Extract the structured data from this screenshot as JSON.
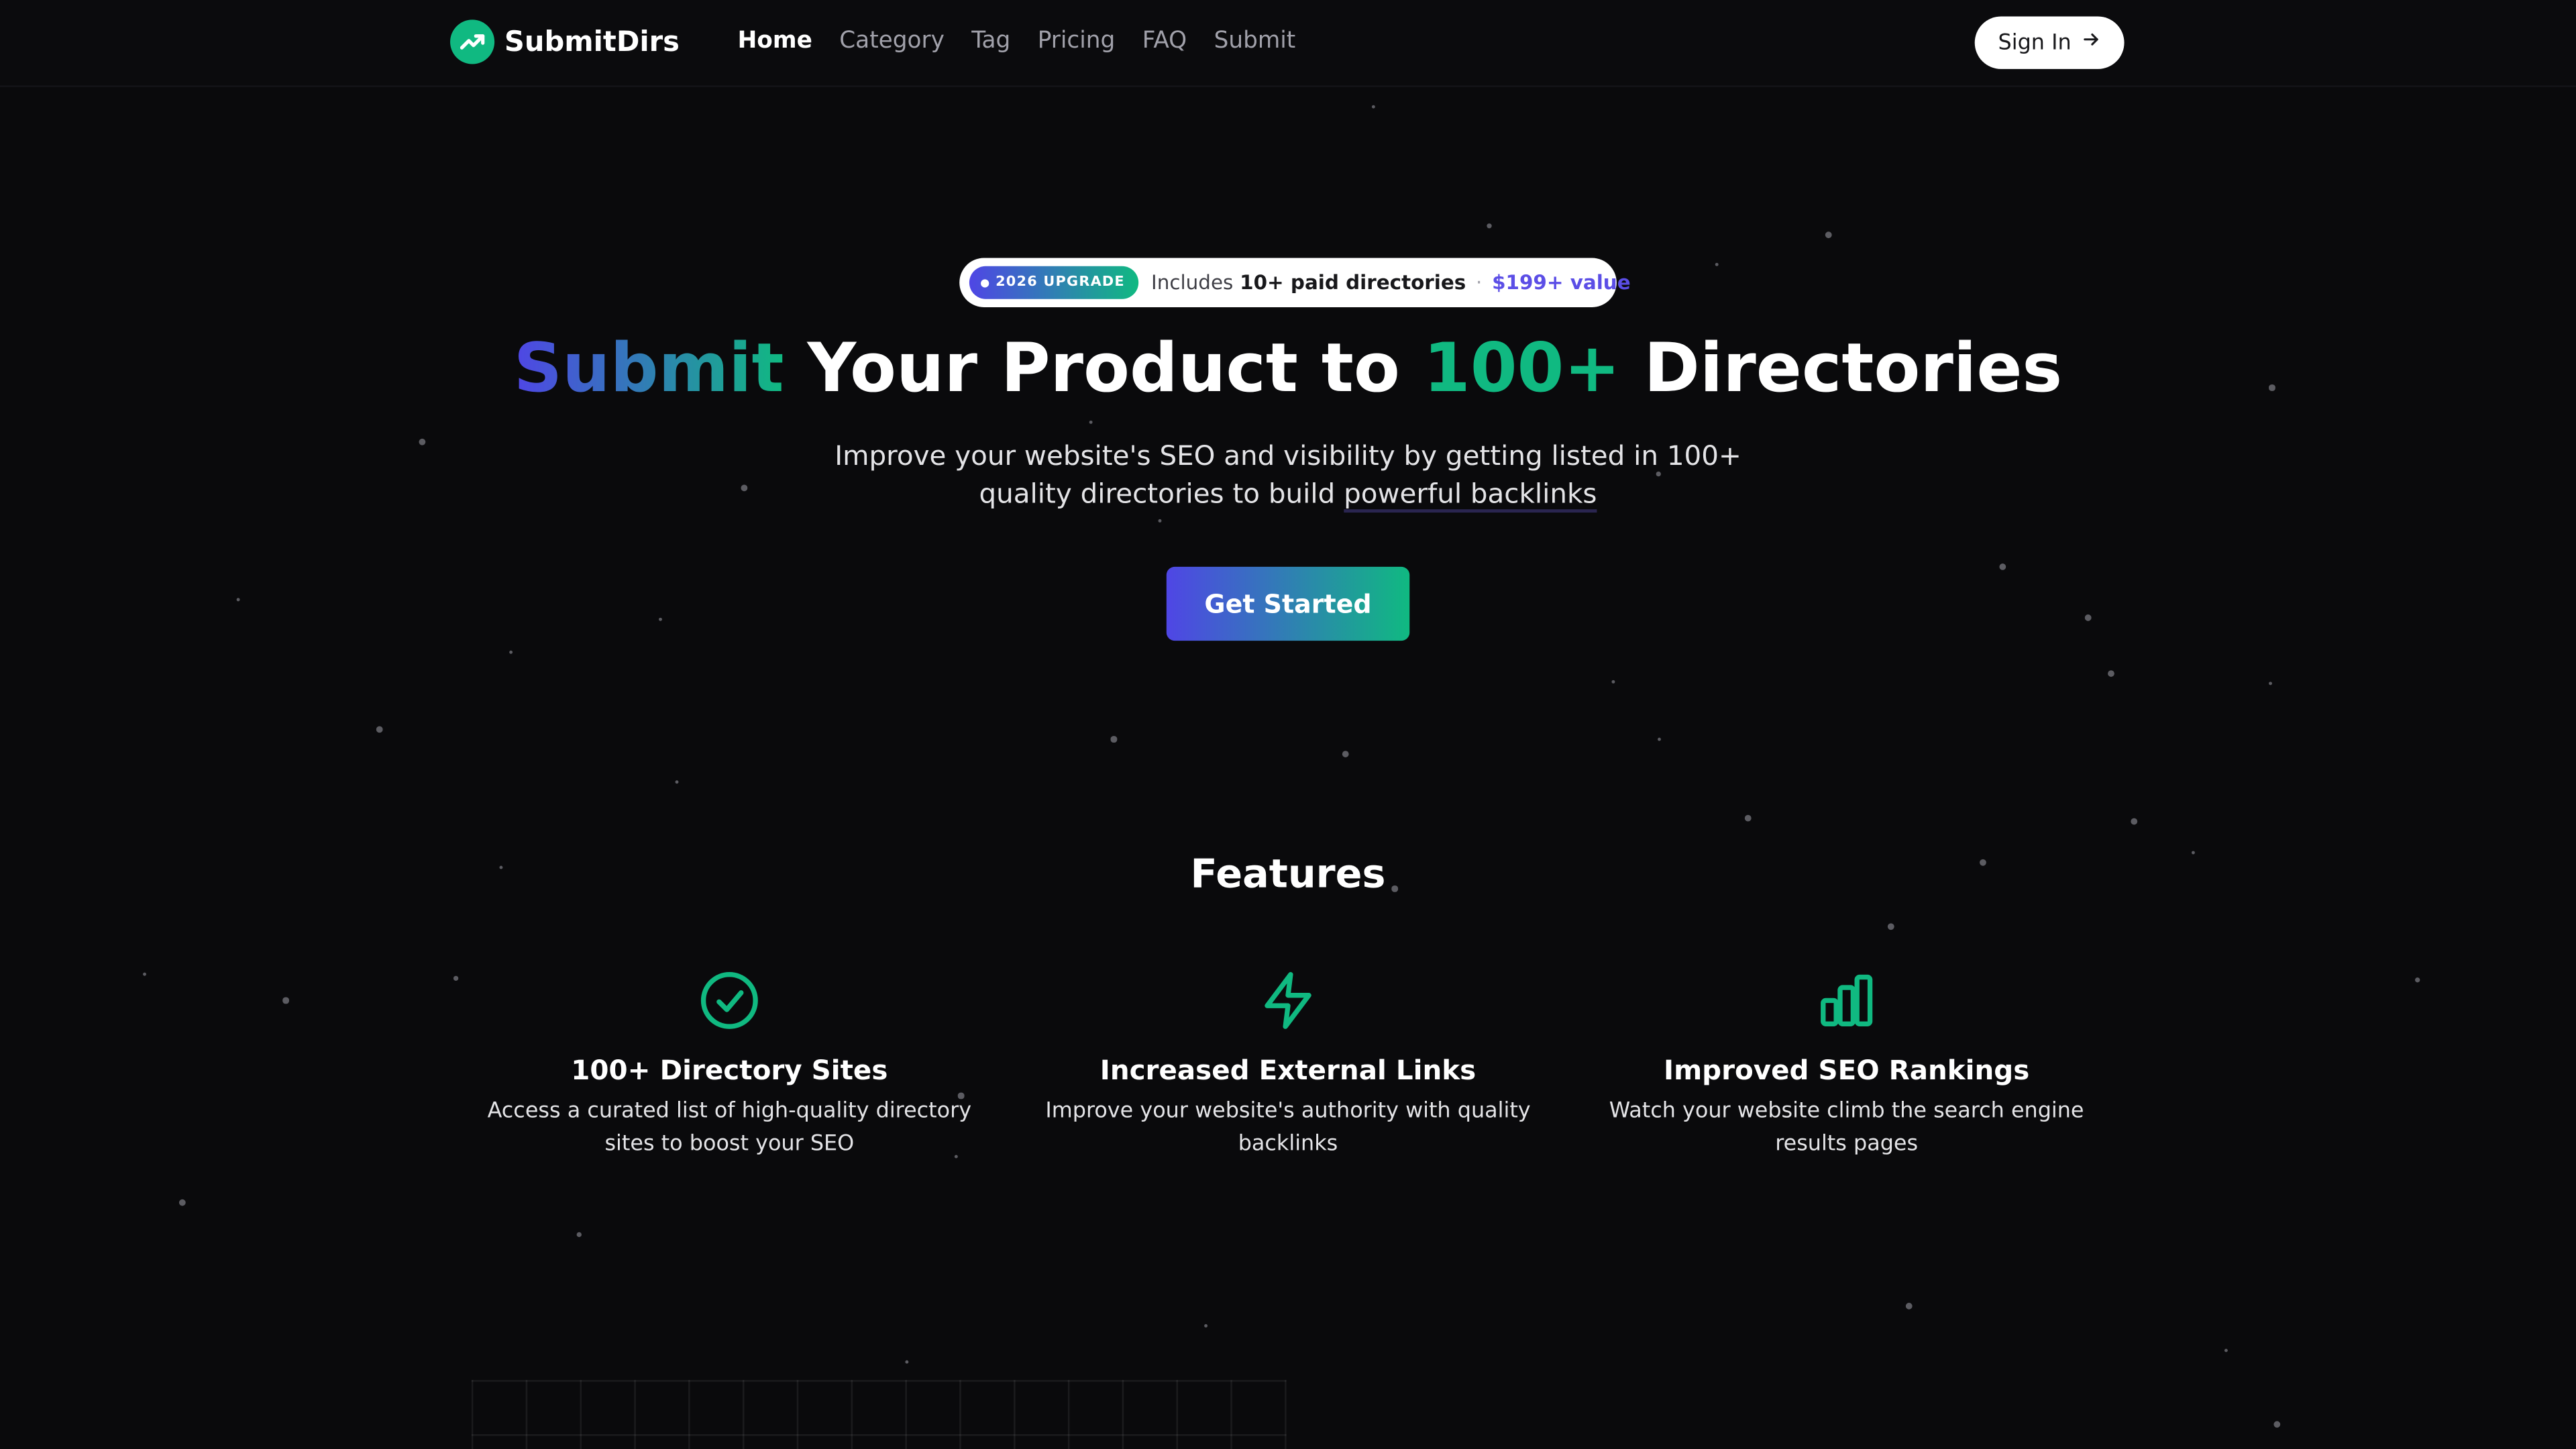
{
  "brand": {
    "name": "SubmitDirs",
    "accent": "#10b981",
    "accent2": "#4f46e5"
  },
  "nav": {
    "items": [
      {
        "label": "Home",
        "active": true
      },
      {
        "label": "Category"
      },
      {
        "label": "Tag"
      },
      {
        "label": "Pricing"
      },
      {
        "label": "FAQ"
      },
      {
        "label": "Submit"
      }
    ],
    "signin_label": "Sign In",
    "signin_icon": "arrow-right-icon"
  },
  "badge": {
    "pill": "2026 UPGRADE",
    "prefix": "Includes",
    "strong": "10+ paid directories",
    "separator": "·",
    "value": "$199+ value"
  },
  "hero": {
    "title_part1": "Submit",
    "title_part2": " Your Product to ",
    "title_part3": "100+",
    "title_part4": " Directories",
    "subtitle_main": "Improve your website's SEO and visibility by getting listed in 100+ quality directories to build ",
    "subtitle_emphasis": "powerful backlinks",
    "cta_label": "Get Started"
  },
  "features": {
    "title": "Features",
    "items": [
      {
        "icon": "check-circle-icon",
        "title": "100+ Directory Sites",
        "desc": "Access a curated list of high-quality directory sites to boost your SEO"
      },
      {
        "icon": "lightning-icon",
        "title": "Increased External Links",
        "desc": "Improve your website's authority with quality backlinks"
      },
      {
        "icon": "bar-chart-icon",
        "title": "Improved SEO Rankings",
        "desc": "Watch your website climb the search engine results pages"
      }
    ]
  }
}
